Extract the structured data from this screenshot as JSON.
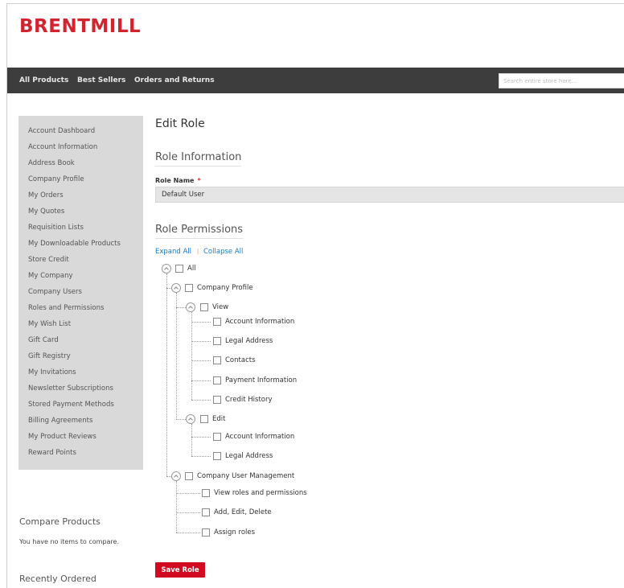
{
  "brand": {
    "logo_text": "BRENTMILL",
    "accent": "#d1242f"
  },
  "nav": {
    "links": [
      "All Products",
      "Best Sellers",
      "Orders and Returns"
    ],
    "search_placeholder": "Search entire store here..."
  },
  "sidebar": {
    "items": [
      "Account Dashboard",
      "Account Information",
      "Address Book",
      "Company Profile",
      "My Orders",
      "My Quotes",
      "Requisition Lists",
      "My Downloadable Products",
      "Store Credit",
      "My Company",
      "Company Users",
      "Roles and Permissions",
      "My Wish List",
      "Gift Card",
      "Gift Registry",
      "My Invitations",
      "Newsletter Subscriptions",
      "Stored Payment Methods",
      "Billing Agreements",
      "My Product Reviews",
      "Reward Points"
    ]
  },
  "compare": {
    "title": "Compare Products",
    "empty": "You have no items to compare."
  },
  "recent": {
    "title": "Recently Ordered"
  },
  "main": {
    "page_title": "Edit Role",
    "role_info_title": "Role Information",
    "role_name_label": "Role Name",
    "required_mark": "*",
    "role_name_value": "Default User",
    "permissions_title": "Role Permissions",
    "expand_all": "Expand All",
    "separator": "|",
    "collapse_all": "Collapse All",
    "tree": {
      "all": "All",
      "company_profile": "Company Profile",
      "view": "View",
      "view_children": [
        "Account Information",
        "Legal Address",
        "Contacts",
        "Payment Information",
        "Credit History"
      ],
      "edit": "Edit",
      "edit_children": [
        "Account Information",
        "Legal Address"
      ],
      "user_mgmt": "Company User Management",
      "user_mgmt_children": [
        "View roles and permissions",
        "Add, Edit, Delete",
        "Assign roles"
      ]
    },
    "save_label": "Save Role"
  }
}
